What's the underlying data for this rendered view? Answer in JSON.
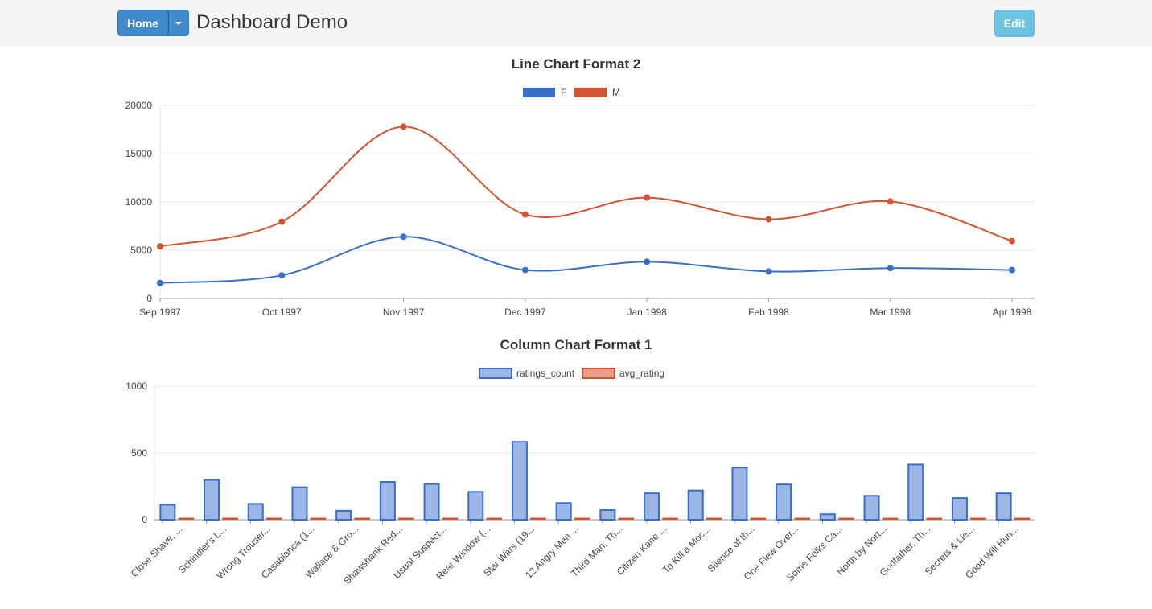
{
  "header": {
    "home_label": "Home",
    "app_title": "Dashboard Demo",
    "edit_label": "Edit"
  },
  "colors": {
    "blue": "#3a6fc7",
    "red": "#d25432",
    "bar_fill": "#9db6e8",
    "bar_stroke": "#3a6fc7",
    "avg_fill": "#ec9e87"
  },
  "chart_data": [
    {
      "type": "line",
      "title": "Line Chart Format 2",
      "x": [
        "Sep 1997",
        "Oct 1997",
        "Nov 1997",
        "Dec 1997",
        "Jan 1998",
        "Feb 1998",
        "Mar 1998",
        "Apr 1998"
      ],
      "series": [
        {
          "name": "F",
          "values": [
            1600,
            2400,
            6400,
            2950,
            3800,
            2800,
            3150,
            2950
          ]
        },
        {
          "name": "M",
          "values": [
            5400,
            7950,
            17800,
            8700,
            10450,
            8200,
            10050,
            5950
          ]
        }
      ],
      "ylim": [
        0,
        20000
      ],
      "yticks": [
        "0",
        "5000",
        "10000",
        "15000",
        "20000"
      ],
      "grid": true,
      "legend": "top"
    },
    {
      "type": "bar",
      "title": "Column Chart Format 1",
      "categories": [
        "Close Shave, ...",
        "Schindler's L...",
        "Wrong Trouser...",
        "Casablanca (1...",
        "Wallace & Gro...",
        "Shawshank Red...",
        "Usual Suspect...",
        "Rear Window (...",
        "Star Wars (19...",
        "12 Angry Men ...",
        "Third Man, Th...",
        "Citizen Kane ...",
        "To Kill a Moc...",
        "Silence of th...",
        "One Flew Over...",
        "Some Folks Ca...",
        "North by Nort...",
        "Godfather, Th...",
        "Secrets & Lie...",
        "Good Will Hun..."
      ],
      "series": [
        {
          "name": "ratings_count",
          "values": [
            112,
            298,
            118,
            243,
            67,
            283,
            267,
            209,
            583,
            125,
            72,
            198,
            219,
            390,
            264,
            41,
            179,
            413,
            162,
            198
          ]
        },
        {
          "name": "avg_rating",
          "values": [
            4.5,
            4.5,
            4.5,
            4.4,
            4.4,
            4.4,
            4.4,
            4.4,
            4.4,
            4.3,
            4.3,
            4.3,
            4.3,
            4.3,
            4.3,
            4.3,
            4.3,
            4.3,
            4.3,
            4.3
          ]
        }
      ],
      "ylim": [
        0,
        1000
      ],
      "yticks": [
        "0",
        "500",
        "1000"
      ],
      "grid": true,
      "legend": "top"
    }
  ]
}
